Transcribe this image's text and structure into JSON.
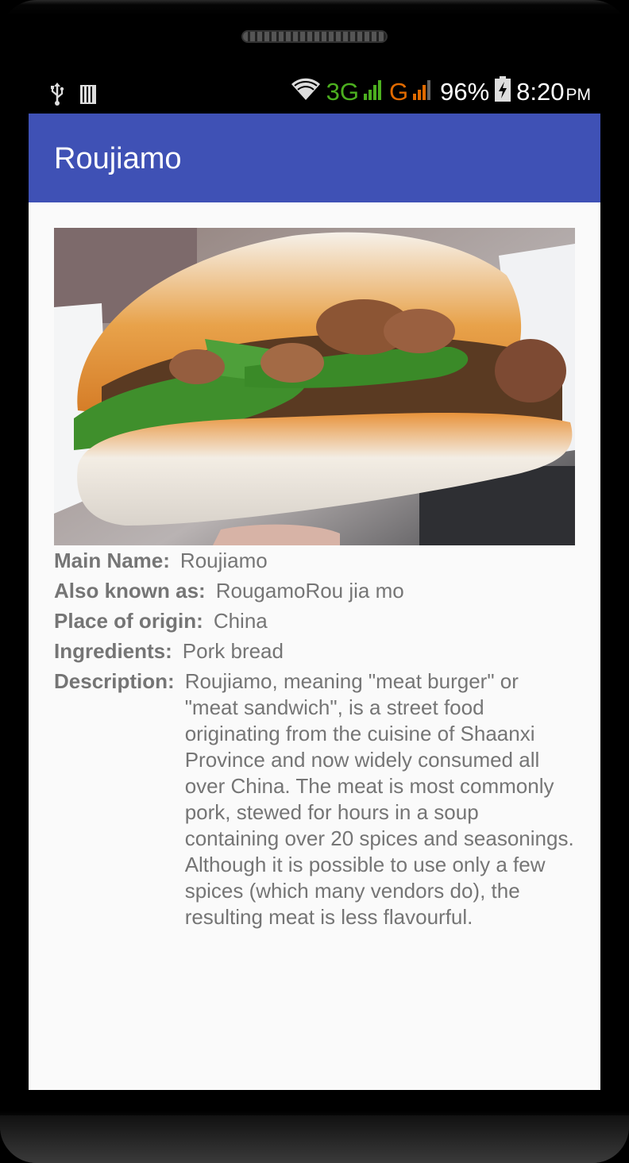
{
  "status_bar": {
    "left_icons": [
      "usb-icon",
      "storage-icon"
    ],
    "network_3g": "3G",
    "network_g": "G",
    "battery": "96%",
    "time": "8:20",
    "ampm": "PM"
  },
  "toolbar": {
    "title": "Roujiamo"
  },
  "food_image": {
    "subject": "roujiamo sandwich photo"
  },
  "details": {
    "main_name_label": "Main Name:",
    "main_name": "Roujiamo",
    "aka_label": "Also known as:",
    "aka": "RougamoRou jia mo",
    "origin_label": "Place of origin:",
    "origin": "China",
    "ingredients_label": "Ingredients:",
    "ingredients": "Pork bread",
    "description_label": "Description:",
    "description": "Roujiamo, meaning \"meat burger\" or \"meat sandwich\", is a street food originating from the cuisine of Shaanxi Province and now widely consumed all over China. The meat is most commonly pork, stewed for hours in a soup containing over 20 spices and seasonings. Although it is possible to use only a few spices (which many vendors do), the resulting meat is less flavourful."
  }
}
